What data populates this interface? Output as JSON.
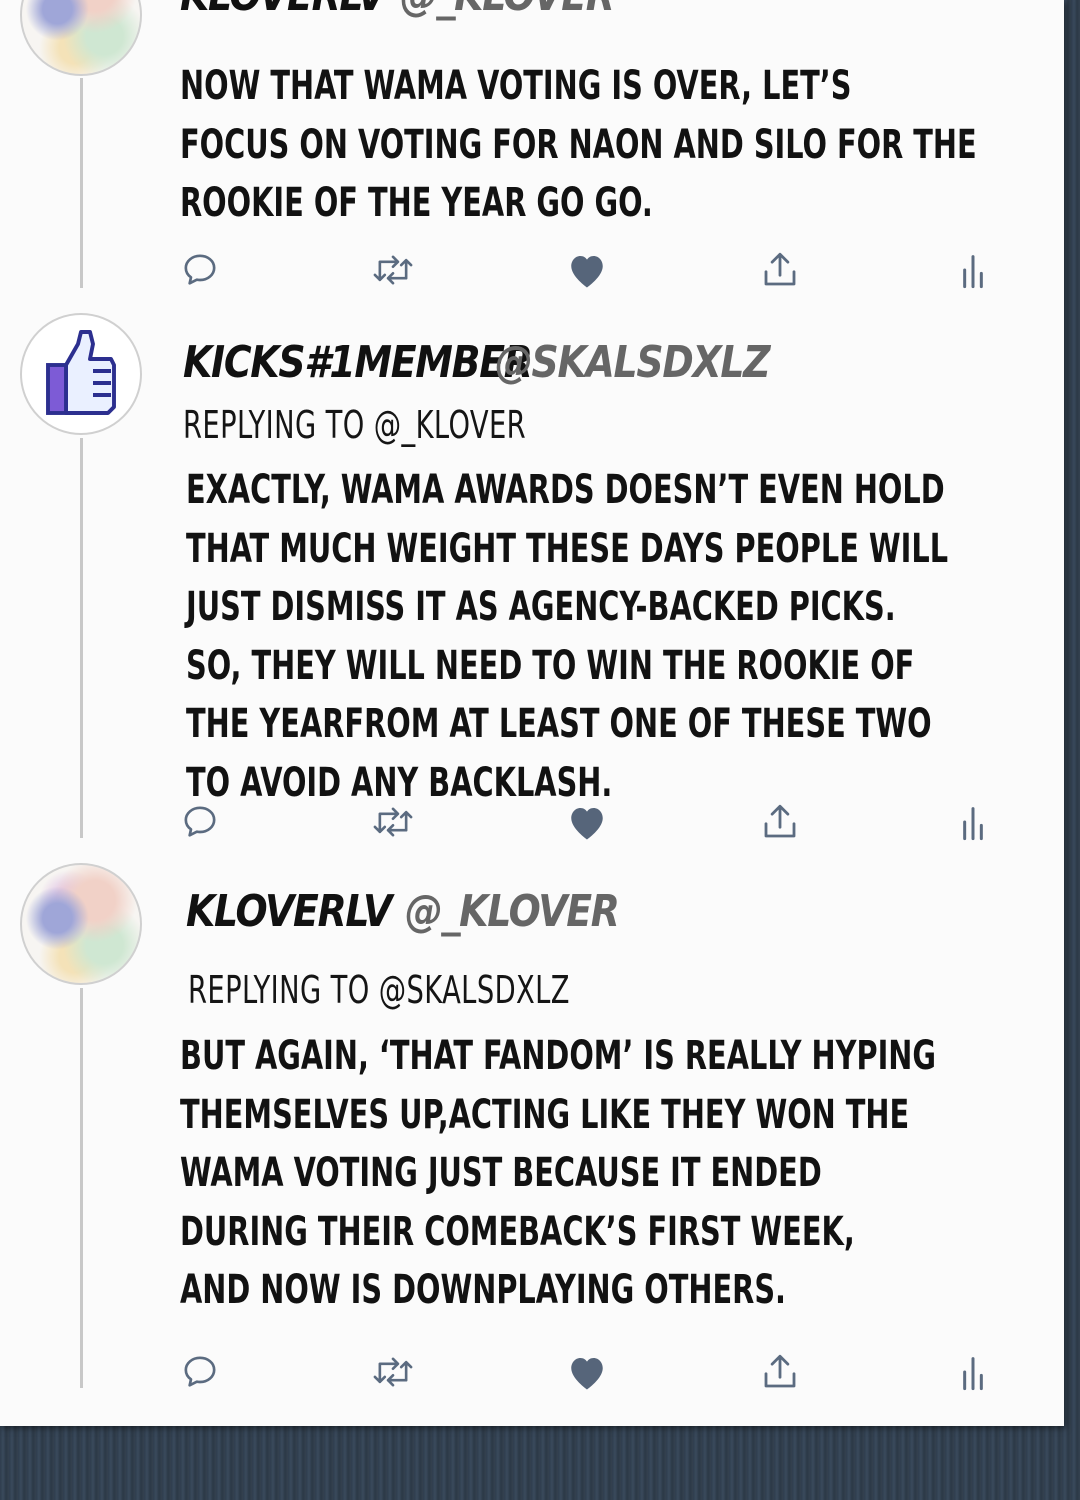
{
  "tweets": [
    {
      "display_name": "KLOVERLV",
      "handle": "@_KLOVER",
      "body_lines": [
        "NOW THAT WAMA VOTING IS OVER, LET’S",
        "FOCUS ON VOTING FOR NAON AND SILO FOR THE",
        "ROOKIE OF THE YEAR GO GO."
      ],
      "avatar_icon": "watercolor-avatar"
    },
    {
      "display_name": "KICKS#1MEMBER",
      "handle": "@SKALSDXLZ",
      "replying_to": "REPLYING TO @_KLOVER",
      "body_lines": [
        "EXACTLY, WAMA AWARDS DOESN’T EVEN HOLD",
        "THAT MUCH WEIGHT THESE DAYS PEOPLE WILL",
        "JUST DISMISS IT AS AGENCY-BACKED PICKS.",
        "SO, THEY WILL NEED TO WIN THE ROOKIE OF",
        "THE YEARFROM AT LEAST ONE OF THESE TWO",
        "TO AVOID ANY BACKLASH."
      ],
      "avatar_icon": "thumbs-up-avatar"
    },
    {
      "display_name": "KLOVERLV",
      "handle": "@_KLOVER",
      "replying_to": "REPLYING TO @SKALSDXLZ",
      "body_lines": [
        "BUT AGAIN, ‘THAT FANDOM’ IS REALLY HYPING",
        "THEMSELVES UP,ACTING LIKE THEY WON THE",
        "WAMA VOTING JUST BECAUSE IT ENDED",
        "DURING THEIR COMEBACK’S FIRST WEEK,",
        "AND NOW IS DOWNPLAYING OTHERS."
      ],
      "avatar_icon": "watercolor-avatar"
    }
  ],
  "actions": [
    "reply-icon",
    "retweet-icon",
    "like-icon",
    "share-icon",
    "analytics-icon"
  ],
  "colors": {
    "icon": "#5b6b80",
    "like_fill": "#56657a",
    "thread_line": "#c8c8c8",
    "text": "#121212",
    "handle": "#666666",
    "panel": "#fbfbfb",
    "background": "#34414f"
  }
}
